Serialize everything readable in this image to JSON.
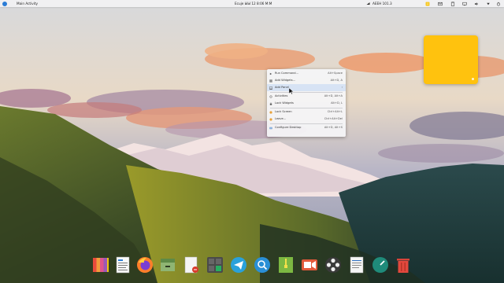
{
  "top_panel": {
    "activity_label": "Main Activity",
    "clock": "Ecuje ЫЫ 12 8:06 M:M",
    "network_label": "AEEH 101.3"
  },
  "context_menu": {
    "items": [
      {
        "label": "Run Command...",
        "shortcut": "Alt+Space",
        "icon": "run-icon"
      },
      {
        "label": "Add Widgets...",
        "shortcut": "Alt+D, A",
        "icon": "widgets-icon"
      },
      {
        "label": "Add Panel",
        "shortcut": "",
        "icon": "panel-icon",
        "highlighted": true
      },
      {
        "label": "Activities",
        "shortcut": "Alt+D, Alt+A",
        "icon": "activities-icon"
      },
      {
        "label": "Lock Widgets",
        "shortcut": "Alt+D, L",
        "icon": "lock-icon"
      },
      {
        "label": "Lock Screen",
        "shortcut": "Ctrl+Alt+L",
        "icon": "lock-screen-icon"
      },
      {
        "label": "Leave...",
        "shortcut": "Ctrl+Alt+Del",
        "icon": "leave-icon"
      },
      {
        "label": "Configure Desktop",
        "shortcut": "Alt+D, Alt+S",
        "icon": "configure-icon"
      }
    ]
  },
  "dock": {
    "icons": [
      "color-palette-icon",
      "text-editor-icon",
      "firefox-icon",
      "archive-icon",
      "document-icon",
      "calculator-icon",
      "telegram-icon",
      "search-icon",
      "zip-icon",
      "screen-recorder-icon",
      "media-player-icon",
      "text-file-icon",
      "timer-icon",
      "trash-icon"
    ]
  },
  "colors": {
    "panel_bg": "#f0f0f2",
    "sticky_note": "#ffc20e",
    "menu_highlight": "#d7e3f4"
  }
}
